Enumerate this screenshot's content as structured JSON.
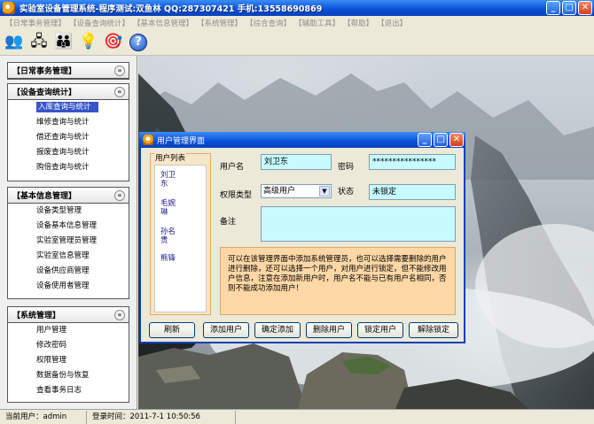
{
  "app": {
    "title": "实验室设备管理系统-程序测试:双鱼林 QQ:287307421 手机:13558690869",
    "window_buttons": {
      "minimize": "_",
      "maximize": "□",
      "close": "✕"
    }
  },
  "menu": [
    "【日常事务管理】",
    "【设备查询统计】",
    "【基本信息管理】",
    "【系统管理】",
    "【综合查询】",
    "【辅助工具】",
    "【帮助】",
    "【退出】"
  ],
  "toolbar": [
    {
      "icon": "users-icon",
      "glyph": "👥"
    },
    {
      "icon": "network-icon",
      "glyph": "🖧"
    },
    {
      "icon": "people-icon",
      "glyph": "👪"
    },
    {
      "icon": "lightbulb-icon",
      "glyph": "💡"
    },
    {
      "icon": "target-icon",
      "glyph": "🎯"
    },
    {
      "icon": "help-icon",
      "glyph": "?"
    }
  ],
  "sidebar": {
    "groups": [
      {
        "title": "【日常事务管理】",
        "chevron": "»",
        "items": []
      },
      {
        "title": "【设备查询统计】",
        "chevron": "«",
        "items": [
          "入库查询与统计",
          "维修查询与统计",
          "借还查询与统计",
          "报废查询与统计",
          "购倍查询与统计"
        ]
      },
      {
        "title": "【基本信息管理】",
        "chevron": "«",
        "items": [
          "设备类型管理",
          "设备基本信息管理",
          "实验室管理员管理",
          "实验室信息管理",
          "设备供应商管理",
          "设备使用者管理"
        ]
      },
      {
        "title": "【系统管理】",
        "chevron": "«",
        "items": [
          "用户管理",
          "修改密码",
          "权限管理",
          "数据备份与恢复",
          "查看事务日志"
        ]
      }
    ]
  },
  "dialog": {
    "title": "用户管理界面",
    "user_list_label": "用户列表",
    "users": [
      "刘卫东",
      "毛婉琳",
      "孙名贵",
      "熊锋"
    ],
    "labels": {
      "username": "用户名",
      "password": "密码",
      "permission": "权限类型",
      "status": "状态",
      "remark": "备注"
    },
    "values": {
      "username": "刘卫东",
      "password": "****************",
      "permission": "高级用户",
      "status": "未锁定",
      "remark": ""
    },
    "info": "可以在该管理界面中添加系统管理员，也可以选择需要删除的用户进行删除，还可以选择一个用户，对用户进行锁定，但不能修改用户信息，注意在添加新用户时，用户名不能与已有用户名相同，否则不能成功添加用户！",
    "buttons": [
      "刷新",
      "添加用户",
      "确定添加",
      "删除用户",
      "锁定用户",
      "解除锁定"
    ]
  },
  "status": {
    "current_user": "当前用户：admin",
    "login_time": "登录时间：2011-7-1 10:50:56"
  }
}
